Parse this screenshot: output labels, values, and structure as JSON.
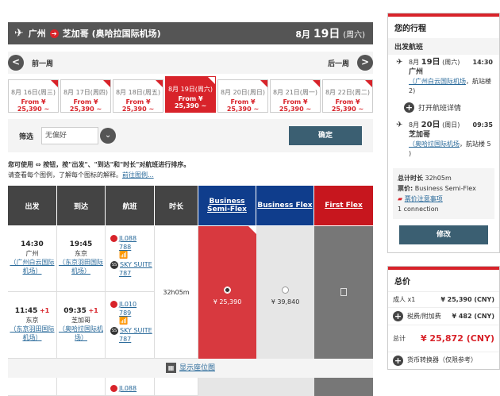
{
  "route": {
    "origin": "广州",
    "destination": "芝加哥 (奥哈拉国际机场)",
    "date_prefix": "8月",
    "date_day": "19日",
    "date_weekday": "(周六)"
  },
  "week_nav": {
    "prev": "前一周",
    "next": "后一周",
    "prev_icon": "<",
    "next_icon": ">"
  },
  "dates": [
    {
      "date": "8月 16日",
      "weekday": "(周三)",
      "price": "From ¥ 25,390 ~"
    },
    {
      "date": "8月 17日",
      "weekday": "(周四)",
      "price": "From ¥ 25,390 ~"
    },
    {
      "date": "8月 18日",
      "weekday": "(周五)",
      "price": "From ¥ 25,390 ~"
    },
    {
      "date": "8月 19日",
      "weekday": "(周六)",
      "price": "From ¥ 25,390 ~"
    },
    {
      "date": "8月 20日",
      "weekday": "(周日)",
      "price": "From ¥ 25,390 ~"
    },
    {
      "date": "8月 21日",
      "weekday": "(周一)",
      "price": "From ¥ 25,390 ~"
    },
    {
      "date": "8月 22日",
      "weekday": "(周二)",
      "price": "From ¥ 25,390 ~"
    }
  ],
  "filter": {
    "label": "筛选",
    "value": "无偏好",
    "confirm": "确定",
    "dropdown_icon": "⌄"
  },
  "info": {
    "line1": "您可使用 ⇔ 按钮，按\"出发\"、\"到达\"和\"时长\"对航班进行排序。",
    "line2": "请查看每个图例，了解每个图标的解释。",
    "link": "前往图例..."
  },
  "table": {
    "headers": {
      "depart": "出发",
      "arrive": "到达",
      "flight": "航班",
      "duration": "时长",
      "bsf": "Business Semi-Flex",
      "bf": "Business Flex",
      "ff": "First Flex"
    },
    "seg1": {
      "dep_time": "14:30",
      "dep_city": "广州",
      "dep_airport": "（广州白云国际机场）",
      "arr_time": "19:45",
      "arr_city": "东京",
      "arr_airport": "（东京羽田国际机场）",
      "flight_no": "JL088",
      "aircraft_no": "788",
      "suite": "SKY SUITE",
      "aircraft_no2": "787"
    },
    "seg2": {
      "dep_time": "11:45",
      "dep_plus": "+1",
      "dep_city": "东京",
      "dep_airport": "（东京羽田国际机场）",
      "arr_time": "09:35",
      "arr_plus": "+1",
      "arr_city": "芝加哥",
      "arr_airport": "（奥哈拉国际机场）",
      "flight_no": "JL010",
      "aircraft_no": "789",
      "suite": "SKY SUITE",
      "aircraft_no2": "787"
    },
    "duration": "32h05m",
    "fare_bsf": "¥ 25,390",
    "fare_bf": "¥ 39,840",
    "seatmap": "显示座位图",
    "next_flight_no": "JL088"
  },
  "itinerary": {
    "title": "您的行程",
    "section": "出发航班",
    "leg1": {
      "date_prefix": "8月",
      "date_day": "19日",
      "weekday": "(周六)",
      "time": "14:30",
      "city": "广州",
      "airport": "（广州白云国际机场",
      "airport_tail": "，航站楼 2)"
    },
    "details": "打开航班详情",
    "leg2": {
      "date_prefix": "8月",
      "date_day": "20日",
      "weekday": "(周日)",
      "time": "09:35",
      "city": "芝加哥",
      "airport": "（奥哈拉国际机场",
      "airport_tail": "，航站楼 5 )"
    },
    "total_time_label": "总计时长",
    "total_time": "32h05m",
    "fare_label": "票价:",
    "fare": "Business Semi-Flex",
    "notice": "票价注意事项",
    "connections": "1 connection",
    "edit": "修改"
  },
  "total": {
    "title": "总价",
    "adult_label": "成人 x1",
    "adult_value": "¥ 25,390 (CNY)",
    "tax_label": "税费/附加费",
    "tax_value": "¥ 482 (CNY)",
    "grand_label": "总计",
    "grand_value": "¥ 25,872 (CNY)",
    "converter": "货币转换器（仅限参考）"
  },
  "colors": {
    "accent": "#d8232a",
    "navy": "#0f3d8c",
    "button": "#3b5f72"
  }
}
